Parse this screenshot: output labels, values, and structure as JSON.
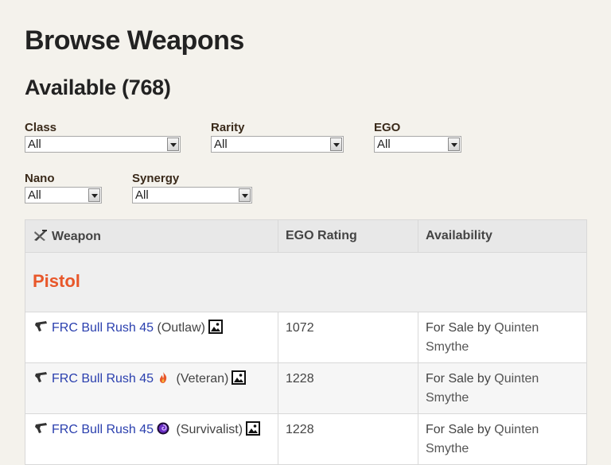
{
  "page": {
    "title": "Browse Weapons",
    "available_heading": "Available (768)"
  },
  "filters": {
    "class": {
      "label": "Class",
      "value": "All"
    },
    "rarity": {
      "label": "Rarity",
      "value": "All"
    },
    "ego": {
      "label": "EGO",
      "value": "All"
    },
    "nano": {
      "label": "Nano",
      "value": "All"
    },
    "synergy": {
      "label": "Synergy",
      "value": "All"
    }
  },
  "table": {
    "headers": {
      "weapon": "Weapon",
      "ego_rating": "EGO Rating",
      "availability": "Availability"
    },
    "group": "Pistol",
    "rows": [
      {
        "name": "FRC Bull Rush 45",
        "variant": "(Outlaw)",
        "ego": "1072",
        "availability_prefix": "For Sale by",
        "seller": "Quinten Smythe"
      },
      {
        "name": "FRC Bull Rush 45",
        "variant": "(Veteran)",
        "ego": "1228",
        "availability_prefix": "For Sale by",
        "seller": "Quinten Smythe",
        "badge_icon": "fire-icon"
      },
      {
        "name": "FRC Bull Rush 45",
        "variant": "(Survivalist)",
        "ego": "1228",
        "availability_prefix": "For Sale by",
        "seller": "Quinten Smythe",
        "badge_icon": "purple-swirl-icon"
      }
    ]
  },
  "colors": {
    "background": "#f4f2ec",
    "link": "#2a3fae",
    "group_title": "#e8572a",
    "header_bg": "#e8e8e8"
  }
}
